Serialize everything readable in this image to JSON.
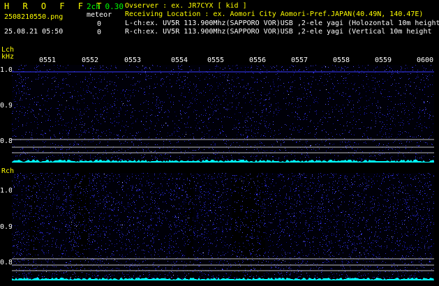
{
  "header": {
    "app_title": "H R O F F T",
    "app_version": "2ch 0.30",
    "mode": "meteor",
    "filename": "2508210550.png",
    "datetime": "25.08.21 05:50",
    "lch_count": "0",
    "rch_count": "0",
    "observer": "Ovserver          : ex. JR7CYX [ kid ]",
    "location": "Receiving Location : ex. Aomori City Aomori-Pref.JAPAN(40.49N, 140.47E)",
    "lch_info": "L-ch:ex. UV5R 113.900Mhz(SAPPORO VOR)USB ,2-ele yagi (Holozontal 10m height",
    "rch_info": "R-ch:ex. UV5R 113.900Mhz(SAPPORO VOR)USB ,2-ele yagi (Vertical 10m height"
  },
  "axes": {
    "lch_label": "Lch",
    "unit": "kHz",
    "rch_label": "Rch",
    "time_labels": [
      "0551",
      "0552",
      "0553",
      "0554",
      "0555",
      "0556",
      "0557",
      "0558",
      "0559",
      "0600"
    ],
    "freq_ticks": [
      "1.0",
      "0.9",
      "0.8"
    ]
  },
  "colors": {
    "accent_yellow": "#ffff00",
    "accent_green": "#00ff00",
    "spectrum_blue": "#1010a0",
    "baseline_cyan": "#00ffff"
  }
}
